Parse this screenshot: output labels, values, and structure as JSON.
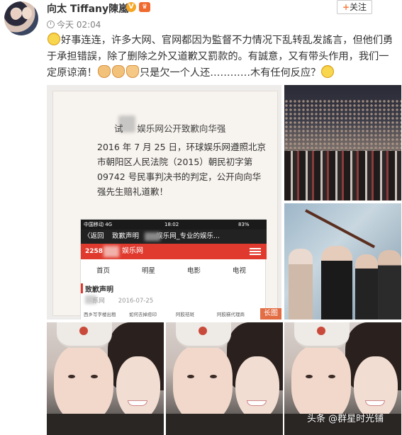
{
  "header": {
    "username": "向太 Tiffany陳嵐",
    "verified_badge": "V",
    "follow_label": "关注",
    "follow_plus": "+",
    "timestamp": "今天 02:04"
  },
  "post": {
    "line1": "好事连连，许多大网、官网都因为監督不力情况下乱转乱发謠言，但他们勇于承担错誤，除了删除之外又道歉又罰款的。有誠意，又有带头作用，我们一定原谅滴！",
    "line2": "只是欠一个人还…………木有任何反应？",
    "emoji_icons": [
      "smile-icon",
      "handshake-icon",
      "thumbs-up-icon",
      "muscle-icon",
      "smile-icon"
    ]
  },
  "document_image": {
    "title": "娱乐网公开致歉向华强",
    "title_prefix": "试",
    "body": "2016 年 7 月 25 日，环球娱乐网遵照北京市朝阳区人民法院（2015）朝民初字第 09742 号民事判决书的判定，公开向向华强先生赔礼道歉！",
    "phone": {
      "carrier": "中国移动  4G",
      "time": "18:02",
      "battery": "83%",
      "back_label": "〈返回",
      "nav_title": "致歉声明",
      "nav_site": "娱乐网_专业的娱乐...",
      "site_number": "2258",
      "site_name": "娱乐网",
      "tabs": [
        "首页",
        "明星",
        "电影",
        "电视"
      ],
      "article_title": "致歉声明",
      "article_source": "乐网",
      "article_date": "2016-07-25",
      "links": [
        "西乡写字楼出租",
        "如何去掉痘印",
        "阿胶祛斑",
        "阿胶糕代理商"
      ]
    },
    "long_image_tag": "长图"
  },
  "watermark": "头条 @群星时光铺"
}
